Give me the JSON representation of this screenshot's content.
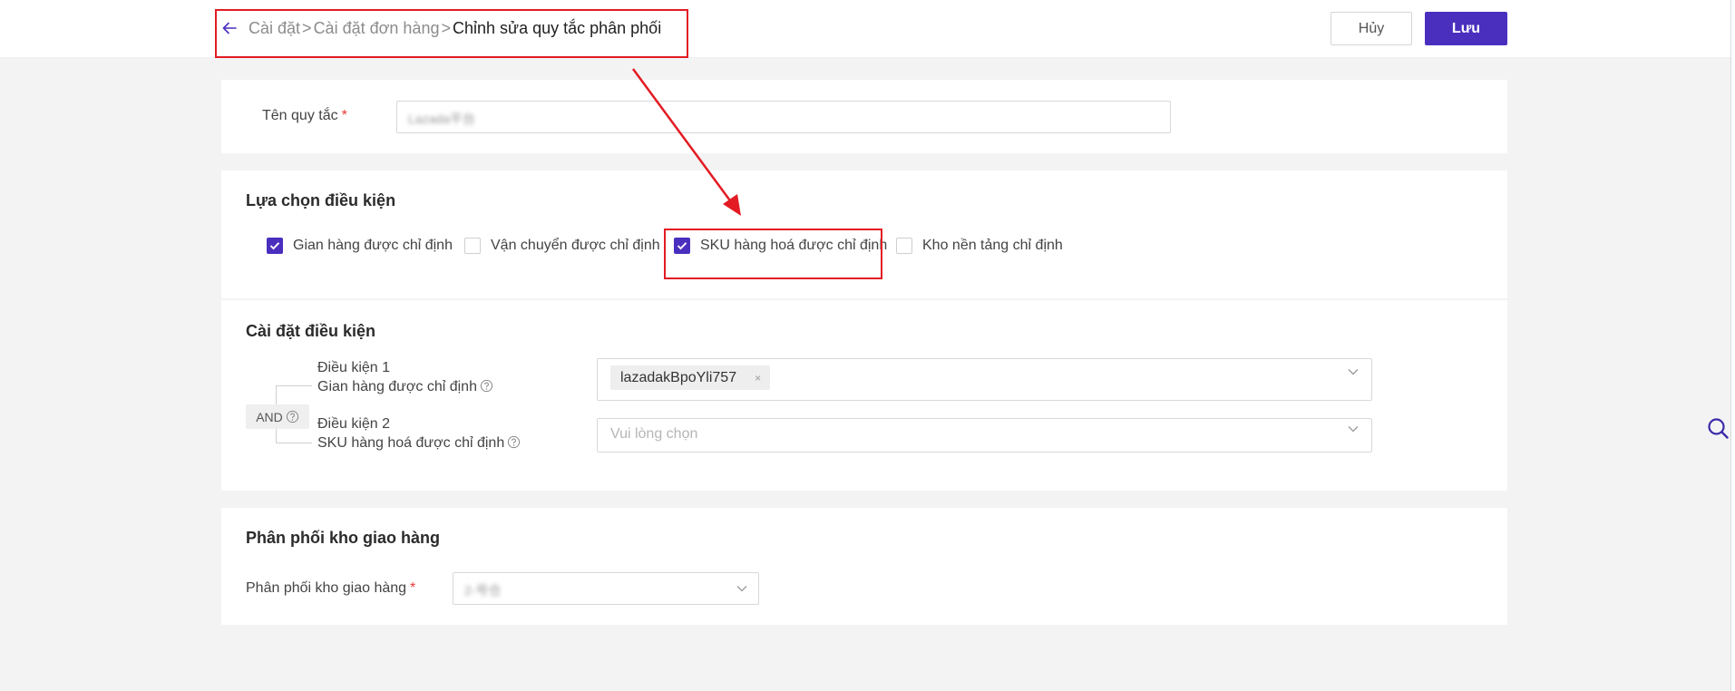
{
  "header": {
    "breadcrumb": [
      "Cài đặt",
      "Cài đặt đơn hàng"
    ],
    "separator": ">",
    "current_page": "Chỉnh sửa quy tắc phân phối",
    "cancel_label": "Hủy",
    "save_label": "Lưu"
  },
  "rule_name": {
    "label": "Tên quy tắc",
    "required_mark": "*",
    "value": "Lazada平台"
  },
  "condition_selection": {
    "title": "Lựa chọn điều kiện",
    "options": [
      {
        "label": "Gian hàng được chỉ định",
        "checked": true
      },
      {
        "label": "Vận chuyển được chỉ định",
        "checked": false
      },
      {
        "label": "SKU hàng hoá được chỉ định",
        "checked": true
      },
      {
        "label": "Kho nền tảng chỉ định",
        "checked": false
      }
    ]
  },
  "condition_settings": {
    "title": "Cài đặt điều kiện",
    "logic": "AND",
    "conditions": [
      {
        "title": "Điều kiện 1",
        "name": "Gian hàng được chỉ định",
        "selected_tag": "lazadakBpoYli757",
        "tag_remove": "×"
      },
      {
        "title": "Điều kiện 2",
        "name": "SKU hàng hoá được chỉ định",
        "placeholder": "Vui lòng chọn"
      }
    ]
  },
  "warehouse_distribution": {
    "title": "Phân phối kho giao hàng",
    "label": "Phân phối kho giao hàng",
    "required_mark": "*",
    "value": "2-号仓"
  },
  "colors": {
    "accent": "#4a2fbf",
    "annotation": "#e31b23",
    "required": "#e53935"
  },
  "icons": [
    "back-arrow-icon",
    "checkmark-icon",
    "help-circle-icon",
    "chevron-down-icon",
    "search-icon"
  ]
}
